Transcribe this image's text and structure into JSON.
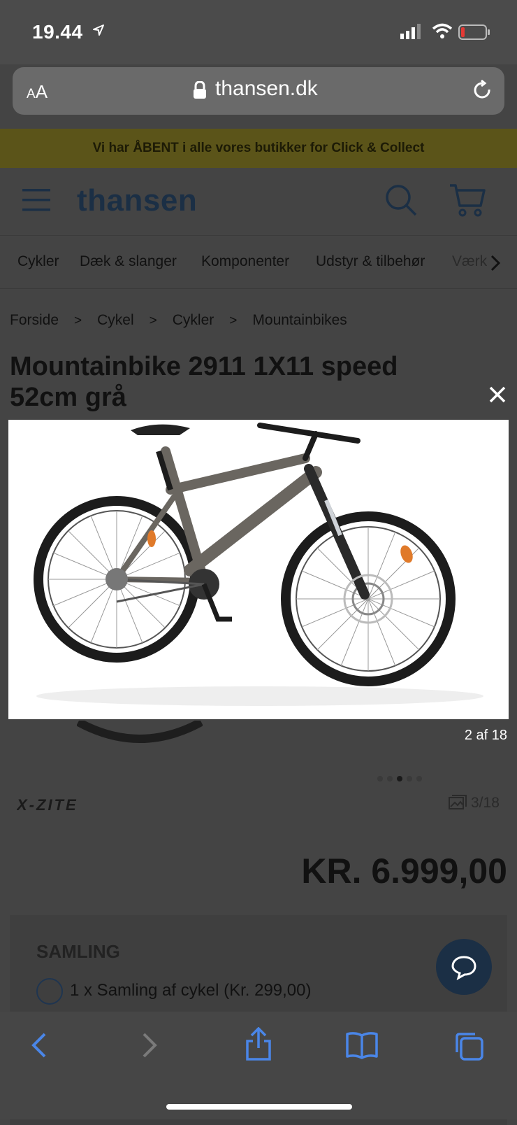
{
  "status": {
    "time": "19.44"
  },
  "browser": {
    "aa": "AA",
    "url": "thansen.dk"
  },
  "banner": {
    "text": "Vi har ÅBENT i alle vores butikker for Click & Collect"
  },
  "header": {
    "logo": "thansen"
  },
  "categories": [
    "Cykler",
    "Dæk & slanger",
    "Komponenter",
    "Udstyr & tilbehør",
    "Værk"
  ],
  "breadcrumb": [
    "Forside",
    "Cykel",
    "Cykler",
    "Mountainbikes"
  ],
  "breadcrumb_sep": ">",
  "product": {
    "title": "Mountainbike 2911 1X11 speed 52cm grå",
    "lightbox_counter": "2 af 18",
    "brand": "X-ZITE",
    "image_count": "3/18",
    "price": "KR. 6.999,00",
    "frame_color": "#6a6660"
  },
  "assembly": {
    "heading": "SAMLING",
    "option": "1 x Samling af cykel (Kr. 299,00)"
  },
  "colors": {
    "brand_navy": "#1b2f45",
    "ios_blue": "#4a86e8"
  },
  "icons": [
    "location-arrow-icon",
    "signal-icon",
    "wifi-icon",
    "battery-icon",
    "lock-icon",
    "reload-icon",
    "hamburger-icon",
    "search-icon",
    "cart-icon",
    "chevron-right-icon",
    "close-icon",
    "gallery-icon",
    "chat-icon",
    "back-icon",
    "forward-icon",
    "share-icon",
    "bookmarks-icon",
    "tabs-icon"
  ]
}
